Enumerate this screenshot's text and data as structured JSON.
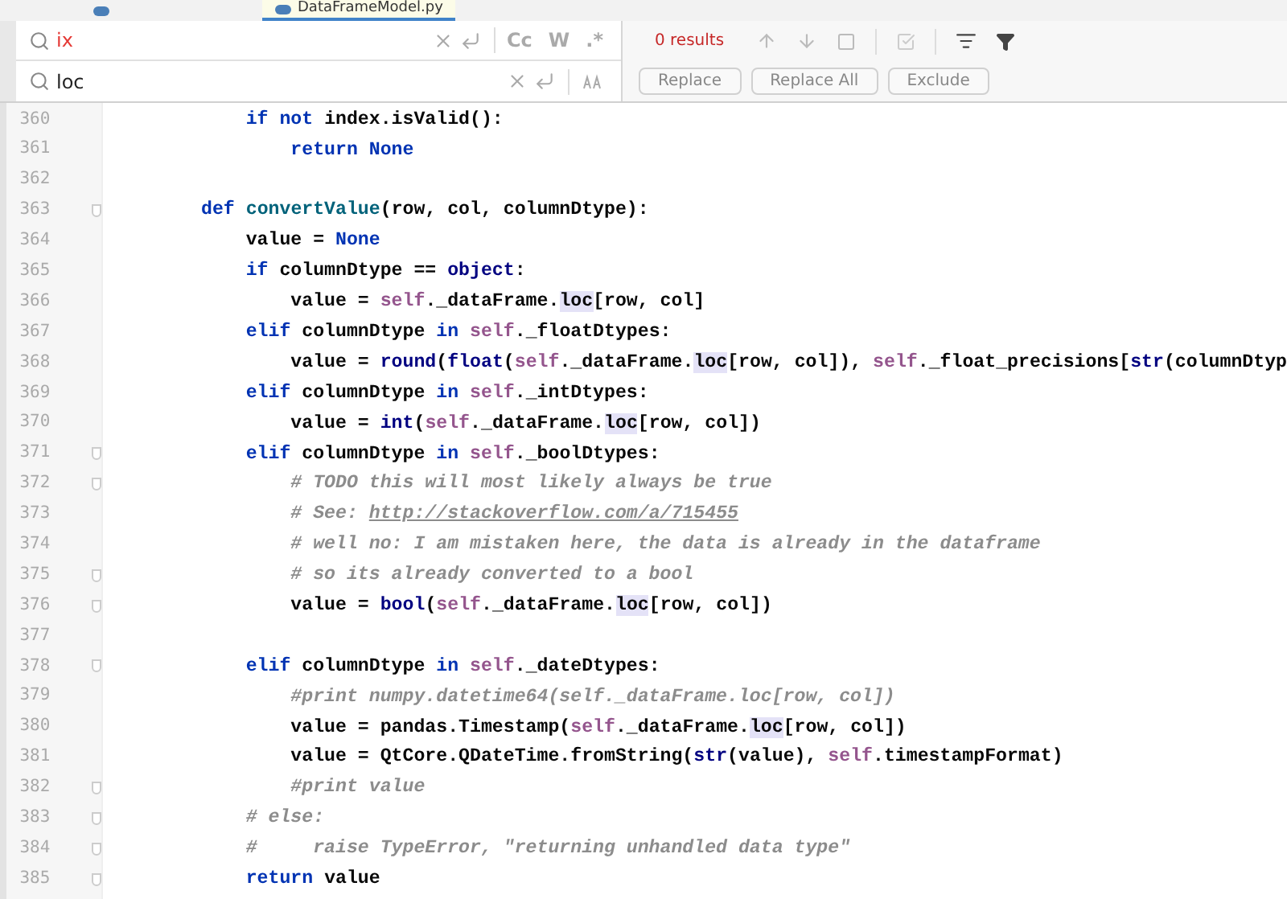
{
  "tabs": [
    {
      "selected": false
    },
    {
      "label": "DataFrameModel.py",
      "selected": true
    }
  ],
  "find": {
    "value": "ix",
    "no_match": true,
    "options": [
      {
        "label": "Cc",
        "on": false
      },
      {
        "label": "W",
        "on": false
      },
      {
        "label": ".*",
        "on": false
      }
    ]
  },
  "results": "0 results",
  "replace": {
    "value": "loc",
    "buttons": [
      "Replace",
      "Replace All",
      "Exclude"
    ]
  },
  "lines": [
    {
      "number": "360",
      "fold": false,
      "tokens": [
        {
          "kind": "kw",
          "text": "        if not "
        },
        {
          "kind": "plain",
          "text": "index.isValid():"
        }
      ]
    },
    {
      "number": "361",
      "fold": false,
      "tokens": [
        {
          "kind": "kw",
          "text": "            return None"
        }
      ]
    },
    {
      "number": "362",
      "fold": false
    },
    {
      "number": "363",
      "fold": true,
      "tokens": [
        {
          "kind": "kw",
          "text": "    def "
        },
        {
          "kind": "fn",
          "text": "convertValue"
        },
        {
          "kind": "plain",
          "text": "(row, col, columnDtype):"
        }
      ]
    },
    {
      "number": "364",
      "fold": false,
      "tokens": [
        {
          "kind": "plain",
          "text": "        value = "
        },
        {
          "kind": "kw",
          "text": "None"
        }
      ]
    },
    {
      "number": "365",
      "fold": false,
      "tokens": [
        {
          "kind": "kw",
          "text": "        if "
        },
        {
          "kind": "plain",
          "text": "columnDtype == "
        },
        {
          "kind": "builtin",
          "text": "object"
        },
        {
          "kind": "plain",
          "text": ":"
        }
      ]
    },
    {
      "number": "366",
      "fold": false,
      "tokens": [
        {
          "kind": "plain",
          "text": "            value = "
        },
        {
          "kind": "self",
          "text": "self"
        },
        {
          "kind": "plain",
          "text": "._dataFrame."
        },
        {
          "kind": "match",
          "text": "loc"
        },
        {
          "kind": "plain",
          "text": "[row, col]"
        }
      ]
    },
    {
      "number": "367",
      "fold": false,
      "tokens": [
        {
          "kind": "kw",
          "text": "        elif "
        },
        {
          "kind": "plain",
          "text": "columnDtype "
        },
        {
          "kind": "kw",
          "text": "in "
        },
        {
          "kind": "self",
          "text": "self"
        },
        {
          "kind": "plain",
          "text": "._floatDtypes:"
        }
      ]
    },
    {
      "number": "368",
      "fold": false,
      "tokens": [
        {
          "kind": "plain",
          "text": "            value = "
        },
        {
          "kind": "builtin",
          "text": "round"
        },
        {
          "kind": "plain",
          "text": "("
        },
        {
          "kind": "builtin",
          "text": "float"
        },
        {
          "kind": "plain",
          "text": "("
        },
        {
          "kind": "self",
          "text": "self"
        },
        {
          "kind": "plain",
          "text": "._dataFrame."
        },
        {
          "kind": "match",
          "text": "loc"
        },
        {
          "kind": "plain",
          "text": "[row, col]), "
        },
        {
          "kind": "self",
          "text": "self"
        },
        {
          "kind": "plain",
          "text": "._float_precisions["
        },
        {
          "kind": "builtin",
          "text": "str"
        },
        {
          "kind": "plain",
          "text": "(columnDtyp"
        }
      ]
    },
    {
      "number": "369",
      "fold": false,
      "tokens": [
        {
          "kind": "kw",
          "text": "        elif "
        },
        {
          "kind": "plain",
          "text": "columnDtype "
        },
        {
          "kind": "kw",
          "text": "in "
        },
        {
          "kind": "self",
          "text": "self"
        },
        {
          "kind": "plain",
          "text": "._intDtypes:"
        }
      ]
    },
    {
      "number": "370",
      "fold": false,
      "tokens": [
        {
          "kind": "plain",
          "text": "            value = "
        },
        {
          "kind": "builtin",
          "text": "int"
        },
        {
          "kind": "plain",
          "text": "("
        },
        {
          "kind": "self",
          "text": "self"
        },
        {
          "kind": "plain",
          "text": "._dataFrame."
        },
        {
          "kind": "match",
          "text": "loc"
        },
        {
          "kind": "plain",
          "text": "[row, col])"
        }
      ]
    },
    {
      "number": "371",
      "fold": true,
      "tokens": [
        {
          "kind": "kw",
          "text": "        elif "
        },
        {
          "kind": "plain",
          "text": "columnDtype "
        },
        {
          "kind": "kw",
          "text": "in "
        },
        {
          "kind": "self",
          "text": "self"
        },
        {
          "kind": "plain",
          "text": "._boolDtypes:"
        }
      ]
    },
    {
      "number": "372",
      "fold": true,
      "tokens": [
        {
          "kind": "comment",
          "text": "            # TODO this will most likely always be true"
        }
      ]
    },
    {
      "number": "373",
      "fold": false,
      "tokens": [
        {
          "kind": "comment",
          "text": "            # See: "
        },
        {
          "kind": "link",
          "text": "http://stackoverflow.com/a/715455"
        }
      ]
    },
    {
      "number": "374",
      "fold": false,
      "tokens": [
        {
          "kind": "comment",
          "text": "            # well no: I am mistaken here, the data is already in the dataframe"
        }
      ]
    },
    {
      "number": "375",
      "fold": true,
      "tokens": [
        {
          "kind": "comment",
          "text": "            # so its already converted to a bool"
        }
      ]
    },
    {
      "number": "376",
      "fold": true,
      "tokens": [
        {
          "kind": "plain",
          "text": "            value = "
        },
        {
          "kind": "builtin",
          "text": "bool"
        },
        {
          "kind": "plain",
          "text": "("
        },
        {
          "kind": "self",
          "text": "self"
        },
        {
          "kind": "plain",
          "text": "._dataFrame."
        },
        {
          "kind": "match",
          "text": "loc"
        },
        {
          "kind": "plain",
          "text": "[row, col])"
        }
      ]
    },
    {
      "number": "377",
      "fold": false
    },
    {
      "number": "378",
      "fold": true,
      "tokens": [
        {
          "kind": "kw",
          "text": "        elif "
        },
        {
          "kind": "plain",
          "text": "columnDtype "
        },
        {
          "kind": "kw",
          "text": "in "
        },
        {
          "kind": "self",
          "text": "self"
        },
        {
          "kind": "plain",
          "text": "._dateDtypes:"
        }
      ]
    },
    {
      "number": "379",
      "fold": false,
      "tokens": [
        {
          "kind": "comment",
          "text": "            #print numpy.datetime64(self._dataFrame.loc[row, col])"
        }
      ]
    },
    {
      "number": "380",
      "fold": false,
      "tokens": [
        {
          "kind": "plain",
          "text": "            value = pandas.Timestamp("
        },
        {
          "kind": "self",
          "text": "self"
        },
        {
          "kind": "plain",
          "text": "._dataFrame."
        },
        {
          "kind": "match",
          "text": "loc"
        },
        {
          "kind": "plain",
          "text": "[row, col])"
        }
      ]
    },
    {
      "number": "381",
      "fold": false,
      "tokens": [
        {
          "kind": "plain",
          "text": "            value = QtCore.QDateTime.fromString("
        },
        {
          "kind": "builtin",
          "text": "str"
        },
        {
          "kind": "plain",
          "text": "(value), "
        },
        {
          "kind": "self",
          "text": "self"
        },
        {
          "kind": "plain",
          "text": ".timestampFormat)"
        }
      ]
    },
    {
      "number": "382",
      "fold": true,
      "tokens": [
        {
          "kind": "comment",
          "text": "            #print value"
        }
      ]
    },
    {
      "number": "383",
      "fold": true,
      "tokens": [
        {
          "kind": "comment",
          "text": "        # else:"
        }
      ]
    },
    {
      "number": "384",
      "fold": true,
      "tokens": [
        {
          "kind": "comment",
          "text": "        #     raise TypeError, \"returning unhandled data type\""
        }
      ]
    },
    {
      "number": "385",
      "fold": true,
      "tokens": [
        {
          "kind": "kw",
          "text": "        return "
        },
        {
          "kind": "plain",
          "text": "value"
        }
      ]
    }
  ]
}
